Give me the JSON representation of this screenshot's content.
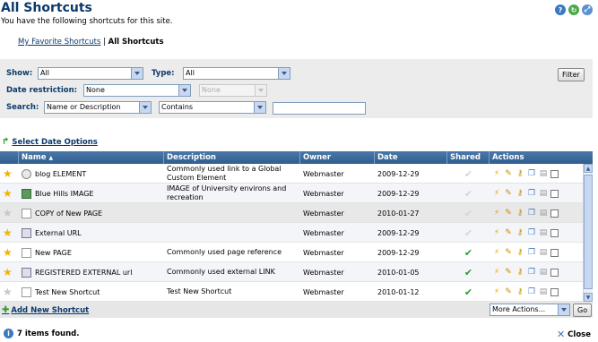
{
  "header": {
    "title": "All Shortcuts",
    "subtitle": "You have the following shortcuts for this site."
  },
  "breadcrumb": {
    "link": "My Favorite Shortcuts",
    "separator": "|",
    "current": "All Shortcuts"
  },
  "filters": {
    "show_label": "Show:",
    "show_value": "All",
    "type_label": "Type:",
    "type_value": "All",
    "date_label": "Date restriction:",
    "date_value": "None",
    "date_value2": "None",
    "search_label": "Search:",
    "search_field": "Name or Description",
    "search_op": "Contains",
    "search_text": "",
    "filter_button": "Filter"
  },
  "select_date_options": "Select Date Options",
  "table": {
    "columns": [
      "Name",
      "Description",
      "Owner",
      "Date",
      "Shared",
      "Actions"
    ],
    "rows": [
      {
        "fav": true,
        "icon": "gear-icon",
        "name": "blog ELEMENT",
        "desc": "Commonly used link to a Global Custom Element",
        "owner": "Webmaster",
        "date": "2009-12-29",
        "shared": false
      },
      {
        "fav": true,
        "icon": "image-icon",
        "name": "Blue Hills IMAGE",
        "desc": "IMAGE of University environs and recreation",
        "owner": "Webmaster",
        "date": "2009-12-29",
        "shared": false
      },
      {
        "fav": false,
        "icon": "page-icon",
        "name": "COPY of New PAGE",
        "desc": "",
        "owner": "Webmaster",
        "date": "2010-01-27",
        "shared": false
      },
      {
        "fav": true,
        "icon": "link-icon",
        "name": "External URL",
        "desc": "",
        "owner": "Webmaster",
        "date": "2009-12-29",
        "shared": false
      },
      {
        "fav": true,
        "icon": "page-icon",
        "name": "New PAGE",
        "desc": "Commonly used page reference",
        "owner": "Webmaster",
        "date": "2009-12-29",
        "shared": true
      },
      {
        "fav": true,
        "icon": "link-icon",
        "name": "REGISTERED EXTERNAL url",
        "desc": "Commonly used external LINK",
        "owner": "Webmaster",
        "date": "2010-01-05",
        "shared": true
      },
      {
        "fav": false,
        "icon": "page-icon",
        "name": "Test New Shortcut",
        "desc": "Test New Shortcut",
        "owner": "Webmaster",
        "date": "2010-01-12",
        "shared": true
      }
    ]
  },
  "footer": {
    "add_new": "Add New Shortcut",
    "more_actions": "More Actions...",
    "go": "Go"
  },
  "status": {
    "count": "7 items found.",
    "close": "Close"
  },
  "colors": {
    "accent": "#0c3a6b",
    "header_bar": "#2f5e90",
    "star": "#f0b400",
    "check_on": "#2e9a2e"
  }
}
